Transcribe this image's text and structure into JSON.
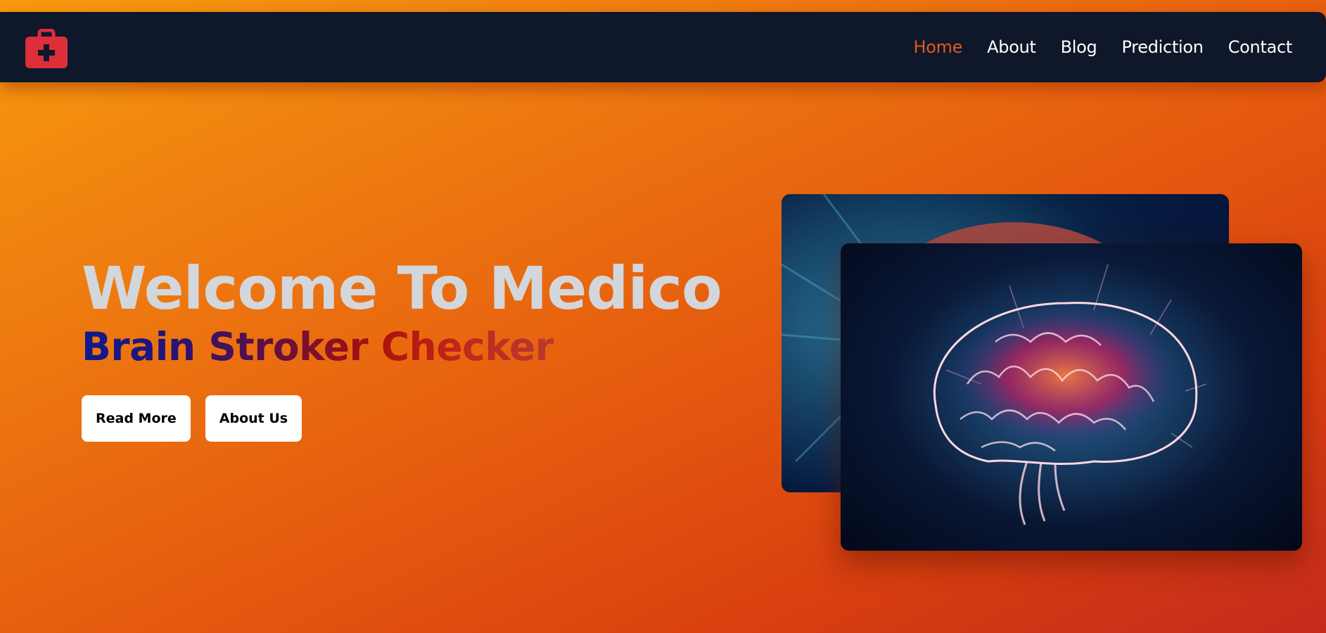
{
  "navbar": {
    "logo_icon": "medical-kit-icon",
    "links": [
      {
        "label": "Home",
        "active": true
      },
      {
        "label": "About",
        "active": false
      },
      {
        "label": "Blog",
        "active": false
      },
      {
        "label": "Prediction",
        "active": false
      },
      {
        "label": "Contact",
        "active": false
      }
    ]
  },
  "hero": {
    "title": "Welcome To Medico",
    "subtitle": "Brain Stroker Checker",
    "buttons": {
      "read_more": "Read More",
      "about_us": "About Us"
    },
    "images": [
      "brain-image-back",
      "brain-image-front"
    ]
  },
  "colors": {
    "navbar_bg": "#0f172a",
    "active_link": "#e2581a",
    "logo_red": "#dc2f3a",
    "title_gray": "#d3d6da"
  }
}
